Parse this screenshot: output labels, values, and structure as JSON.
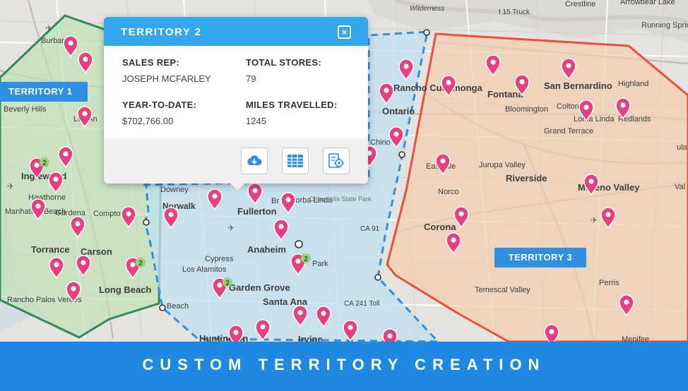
{
  "map": {
    "place_labels": [
      "Burbank",
      "Beverly Hills",
      "Los An",
      "Inglewood",
      "Hawthorne",
      "Manhattan Beach",
      "Gardena",
      "Compton",
      "Torrance",
      "Carson",
      "Long Beach",
      "Rancho Palos Verdes",
      "Downey",
      "Norwalk",
      "Fullerton",
      "Yorba Linda",
      "Chino Hills State Park",
      "Anaheim",
      "Los Alamitos",
      "Cypress",
      "Garden Grove",
      "Santa Ana",
      "Park",
      "CA 91",
      "CA 241 Toll",
      "Huntington",
      "Irvine",
      "Beach",
      "Rancho Cucamonga",
      "Ontario",
      "Chino",
      "Fontana",
      "San Bernardino",
      "Highland",
      "Bloomington",
      "Colton",
      "Loma Linda",
      "Redlands",
      "Grand Terrace",
      "Eastvale",
      "Jurupa Valley",
      "Norco",
      "Riverside",
      "Moreno Valley",
      "Corona",
      "Temescal Valley",
      "Perris",
      "Menifee",
      "Crestline",
      "Arrowbear Lake",
      "Running Springs",
      "I 15 Truck",
      "Wilderness",
      "ula",
      "Val",
      "Br"
    ],
    "cluster_counts": [
      "2",
      "2",
      "2",
      "2"
    ],
    "colors": {
      "territory1": "#2e8b57",
      "territory2": "#2f8fe0",
      "territory3": "#e8503a",
      "pin": "#e8407e"
    }
  },
  "territories": {
    "t1_label": "TERRITORY 1",
    "t3_label": "TERRITORY 3"
  },
  "popup": {
    "title": "TERRITORY 2",
    "close_glyph": "×",
    "sales_rep_label": "SALES REP:",
    "sales_rep_value": "JOSEPH MCFARLEY",
    "total_stores_label": "TOTAL STORES:",
    "total_stores_value": "79",
    "ytd_label": "YEAR-TO-DATE:",
    "ytd_value": "$702,766.00",
    "miles_label": "MILES TRAVELLED:",
    "miles_value": "1245",
    "buttons": [
      "cloud-download-icon",
      "table-grid-icon",
      "settings-report-icon"
    ]
  },
  "banner": {
    "text": "CUSTOM TERRITORY CREATION"
  }
}
